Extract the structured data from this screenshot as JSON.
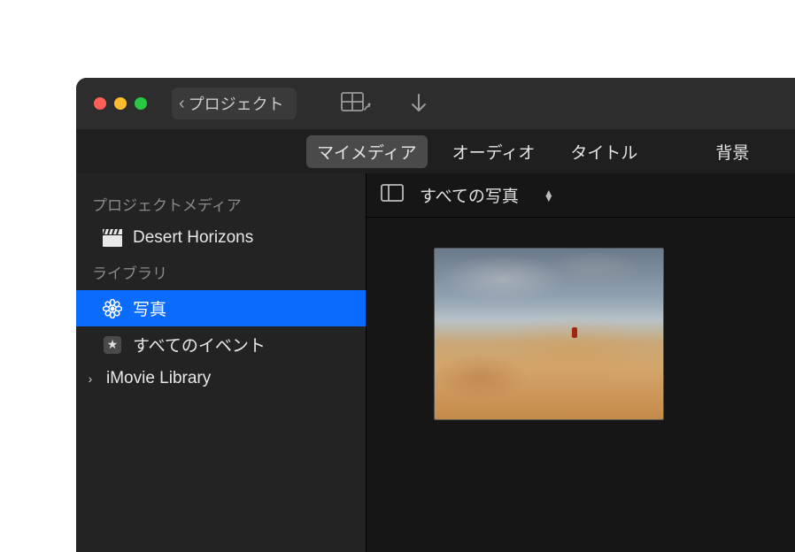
{
  "toolbar": {
    "back_label": "プロジェクト"
  },
  "tabs": {
    "my_media": "マイメディア",
    "audio": "オーディオ",
    "titles": "タイトル",
    "backgrounds": "背景"
  },
  "sidebar": {
    "section_project_media": "プロジェクトメディア",
    "project_name": "Desert Horizons",
    "section_library": "ライブラリ",
    "photos": "写真",
    "all_events": "すべてのイベント",
    "imovie_library": "iMovie Library"
  },
  "panel": {
    "filter_label": "すべての写真"
  }
}
